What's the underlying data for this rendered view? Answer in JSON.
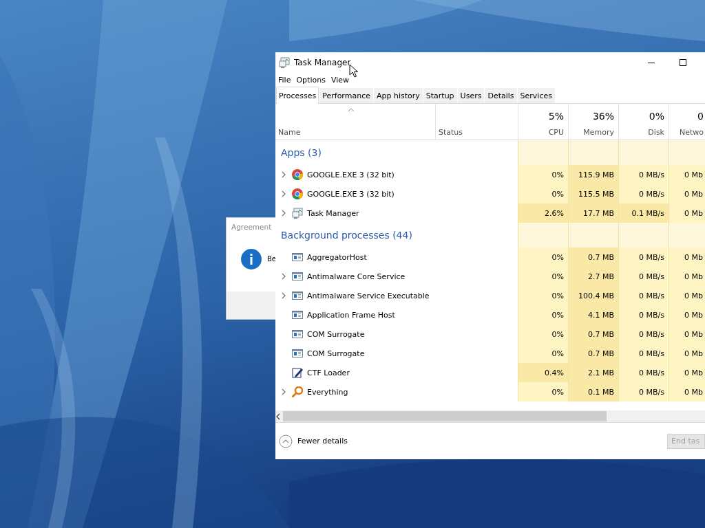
{
  "background": {
    "kind": "picture"
  },
  "dialog": {
    "title": "Agreement",
    "message": "Be"
  },
  "window": {
    "title": "Task Manager"
  },
  "menu": [
    "File",
    "Options",
    "View"
  ],
  "tabs": [
    {
      "label": "Processes",
      "selected": true
    },
    {
      "label": "Performance",
      "selected": false
    },
    {
      "label": "App history",
      "selected": false
    },
    {
      "label": "Startup",
      "selected": false
    },
    {
      "label": "Users",
      "selected": false
    },
    {
      "label": "Details",
      "selected": false
    },
    {
      "label": "Services",
      "selected": false
    }
  ],
  "columns": [
    {
      "label": "Name"
    },
    {
      "label": "Status"
    },
    {
      "label": "CPU",
      "total": "5%"
    },
    {
      "label": "Memory",
      "total": "36%"
    },
    {
      "label": "Disk",
      "total": "0%"
    },
    {
      "label": "Netwo",
      "total": "0"
    }
  ],
  "groups": [
    {
      "title": "Apps (3)",
      "rows": [
        {
          "name": "GOOGLE.EXE 3 (32 bit)",
          "kind": "chrome",
          "expandable": true,
          "values": [
            {
              "text": "0%",
              "hot": false
            },
            {
              "text": "115.9 MB",
              "hot": true
            },
            {
              "text": "0 MB/s",
              "hot": false
            },
            {
              "text": "0 Mb",
              "hot": false
            }
          ]
        },
        {
          "name": "GOOGLE.EXE 3 (32 bit)",
          "kind": "chrome",
          "expandable": true,
          "values": [
            {
              "text": "0%",
              "hot": false
            },
            {
              "text": "115.5 MB",
              "hot": true
            },
            {
              "text": "0 MB/s",
              "hot": false
            },
            {
              "text": "0 Mb",
              "hot": false
            }
          ]
        },
        {
          "name": "Task Manager",
          "kind": "monitor",
          "expandable": true,
          "values": [
            {
              "text": "2.6%",
              "hot": true
            },
            {
              "text": "17.7 MB",
              "hot": true
            },
            {
              "text": "0.1 MB/s",
              "hot": true
            },
            {
              "text": "0 Mb",
              "hot": false
            }
          ]
        }
      ]
    },
    {
      "title": "Background processes (44)",
      "rows": [
        {
          "name": "AggregatorHost",
          "kind": "service",
          "expandable": false,
          "values": [
            {
              "text": "0%",
              "hot": false
            },
            {
              "text": "0.7 MB",
              "hot": true
            },
            {
              "text": "0 MB/s",
              "hot": false
            },
            {
              "text": "0 Mb",
              "hot": false
            }
          ]
        },
        {
          "name": "Antimalware Core Service",
          "kind": "service",
          "expandable": true,
          "values": [
            {
              "text": "0%",
              "hot": false
            },
            {
              "text": "2.7 MB",
              "hot": true
            },
            {
              "text": "0 MB/s",
              "hot": false
            },
            {
              "text": "0 Mb",
              "hot": false
            }
          ]
        },
        {
          "name": "Antimalware Service Executable",
          "kind": "service",
          "expandable": true,
          "values": [
            {
              "text": "0%",
              "hot": false
            },
            {
              "text": "100.4 MB",
              "hot": true
            },
            {
              "text": "0 MB/s",
              "hot": false
            },
            {
              "text": "0 Mb",
              "hot": false
            }
          ]
        },
        {
          "name": "Application Frame Host",
          "kind": "service",
          "expandable": false,
          "values": [
            {
              "text": "0%",
              "hot": false
            },
            {
              "text": "4.1 MB",
              "hot": true
            },
            {
              "text": "0 MB/s",
              "hot": false
            },
            {
              "text": "0 Mb",
              "hot": false
            }
          ]
        },
        {
          "name": "COM Surrogate",
          "kind": "service",
          "expandable": false,
          "values": [
            {
              "text": "0%",
              "hot": false
            },
            {
              "text": "0.7 MB",
              "hot": true
            },
            {
              "text": "0 MB/s",
              "hot": false
            },
            {
              "text": "0 Mb",
              "hot": false
            }
          ]
        },
        {
          "name": "COM Surrogate",
          "kind": "service",
          "expandable": false,
          "values": [
            {
              "text": "0%",
              "hot": false
            },
            {
              "text": "0.7 MB",
              "hot": true
            },
            {
              "text": "0 MB/s",
              "hot": false
            },
            {
              "text": "0 Mb",
              "hot": false
            }
          ]
        },
        {
          "name": "CTF Loader",
          "kind": "pen",
          "expandable": false,
          "values": [
            {
              "text": "0.4%",
              "hot": true
            },
            {
              "text": "2.1 MB",
              "hot": true
            },
            {
              "text": "0 MB/s",
              "hot": false
            },
            {
              "text": "0 Mb",
              "hot": false
            }
          ]
        },
        {
          "name": "Everything",
          "kind": "magnifier",
          "expandable": true,
          "values": [
            {
              "text": "0%",
              "hot": false
            },
            {
              "text": "0.1 MB",
              "hot": true
            },
            {
              "text": "0 MB/s",
              "hot": false
            },
            {
              "text": "0 Mb",
              "hot": false
            }
          ]
        }
      ]
    }
  ],
  "footer": {
    "details_link": "Fewer details",
    "end_button": {
      "label": "End tas",
      "disabled": true
    }
  }
}
